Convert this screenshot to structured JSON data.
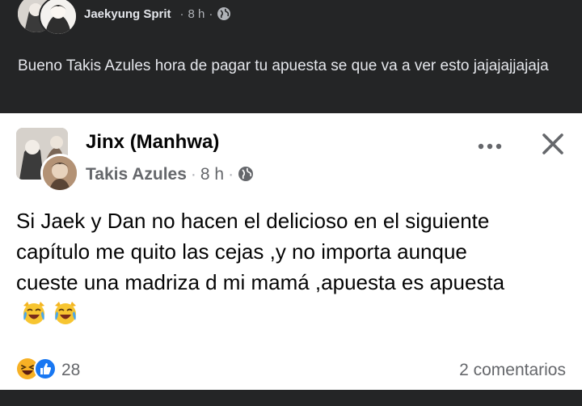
{
  "dark_post": {
    "author": "Jaekyung Sprit",
    "time": "8 h",
    "text": "Bueno Takis Azules  hora de pagar tu apuesta se que va a ver esto jajajajjajaja"
  },
  "shared_post": {
    "page_name": "Jinx (Manhwa)",
    "author": "Takis Azules",
    "time": "8 h",
    "text": "Si Jaek y Dan no hacen el delicioso en el siguiente capítulo me quito las cejas ,y no importa aunque cueste una madriza d mi mamá ,apuesta es apuesta",
    "emojis": [
      "crying-laughing-cat-icon",
      "crying-laughing-cat-icon"
    ]
  },
  "footer": {
    "reactions": [
      "laughing-reaction-icon",
      "like-reaction-icon"
    ],
    "reaction_count": "28",
    "comments_label": "2 comentarios"
  },
  "colors": {
    "dark_bg": "#242526",
    "dark_text": "#e4e6eb",
    "muted": "#65676b",
    "like_blue": "#1877f2",
    "haha_yellow": "#f7b125"
  }
}
